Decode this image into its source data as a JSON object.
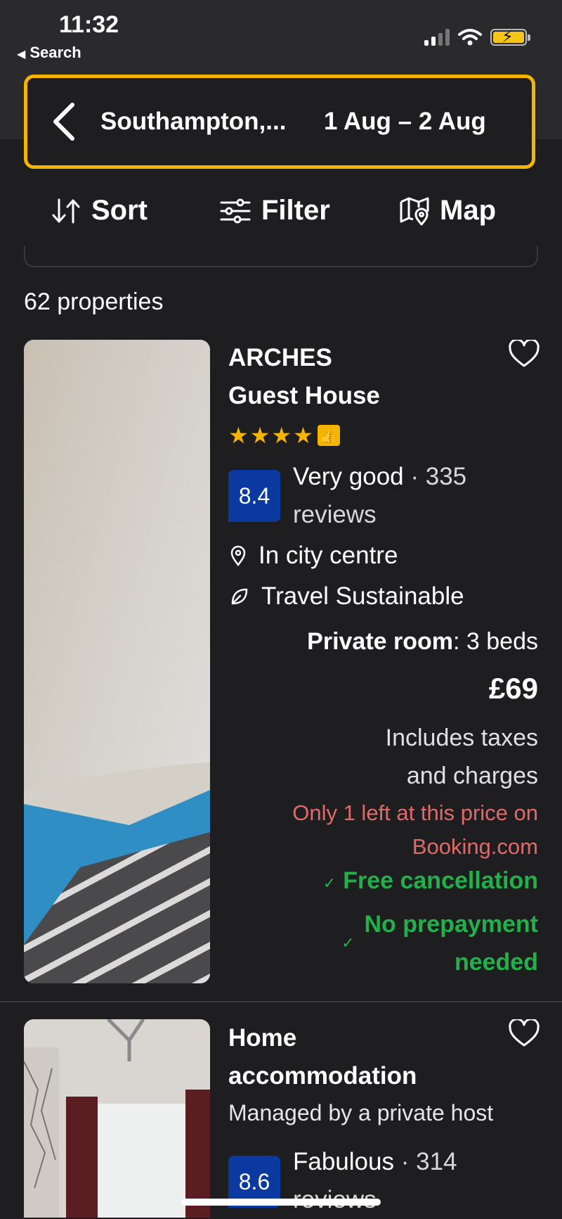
{
  "status_bar": {
    "time": "11:32",
    "back_app": "Search"
  },
  "search": {
    "destination": "Southampton,...",
    "dates": "1 Aug  –  2 Aug"
  },
  "toolbar": {
    "sort": "Sort",
    "filter": "Filter",
    "map": "Map"
  },
  "results": {
    "count_label": "62 properties"
  },
  "properties": [
    {
      "name_line1": "ARCHES",
      "name_line2": "Guest House",
      "stars": 4,
      "score": "8.4",
      "rating_label": "Very good",
      "reviews_a": "· 335",
      "reviews_b": "reviews",
      "location": "In city centre",
      "sustainability": "Travel Sustainable",
      "room_type": "Private room",
      "room_beds": ": 3 beds",
      "price": "£69",
      "taxes_line1": "Includes taxes",
      "taxes_line2": "and charges",
      "scarcity_line1": "Only 1 left at this price on",
      "scarcity_line2": "Booking.com",
      "free_cancellation": "Free cancellation",
      "no_prepayment_line1": "No prepayment",
      "no_prepayment_line2": "needed"
    },
    {
      "name_line1": "Home",
      "name_line2": "accommodation",
      "managed_by": "Managed by a private host",
      "score": "8.6",
      "rating_label": "Fabulous",
      "reviews_a": "· 314",
      "reviews_b": "reviews"
    }
  ],
  "colors": {
    "accent": "#f5b400",
    "score_bg": "#0a3aa0",
    "positive": "#22b04a",
    "scarcity": "#e06a6a"
  }
}
